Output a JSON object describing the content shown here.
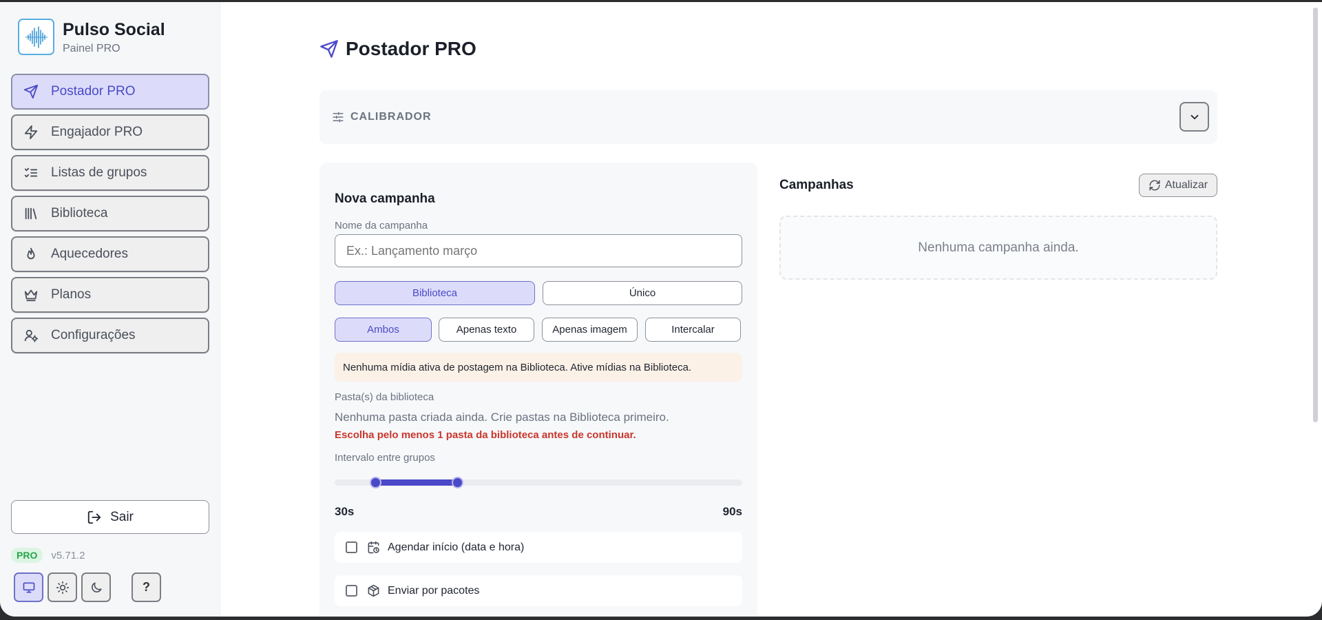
{
  "brand": {
    "title": "Pulso Social",
    "subtitle": "Painel PRO"
  },
  "nav": {
    "items": [
      {
        "label": "Postador PRO",
        "icon": "send-icon",
        "active": true
      },
      {
        "label": "Engajador PRO",
        "icon": "zap-icon"
      },
      {
        "label": "Listas de grupos",
        "icon": "list-checks-icon"
      },
      {
        "label": "Biblioteca",
        "icon": "library-icon"
      },
      {
        "label": "Aquecedores",
        "icon": "flame-icon"
      },
      {
        "label": "Planos",
        "icon": "crown-icon"
      },
      {
        "label": "Configurações",
        "icon": "user-cog-icon"
      }
    ]
  },
  "footer": {
    "logout_label": "Sair",
    "badge": "PRO",
    "version": "v5.71.2",
    "help_label": "?"
  },
  "page": {
    "title": "Postador PRO"
  },
  "calibrator": {
    "label": "CALIBRADOR"
  },
  "form": {
    "title": "Nova campanha",
    "name_label": "Nome da campanha",
    "name_placeholder": "Ex.: Lançamento março",
    "source_options": [
      "Biblioteca",
      "Único"
    ],
    "source_selected": "Biblioteca",
    "content_options": [
      "Ambos",
      "Apenas texto",
      "Apenas imagem",
      "Intercalar"
    ],
    "content_selected": "Ambos",
    "warning": "Nenhuma mídia ativa de postagem na Biblioteca. Ative mídias na Biblioteca.",
    "folders_label": "Pasta(s) da biblioteca",
    "folders_empty": "Nenhuma pasta criada ainda. Crie pastas na Biblioteca primeiro.",
    "folders_error": "Escolha pelo menos 1 pasta da biblioteca antes de continuar.",
    "interval_label": "Intervalo entre grupos",
    "interval_min_label": "30s",
    "interval_max_label": "90s",
    "interval_selection_fraction": [
      0.1,
      0.3
    ],
    "schedule_label": "Agendar início (data e hora)",
    "batches_label": "Enviar por pacotes"
  },
  "campaigns": {
    "title": "Campanhas",
    "refresh_label": "Atualizar",
    "empty": "Nenhuma campanha ainda."
  },
  "colors": {
    "accent": "#4a49c8",
    "accent_bg": "#dcdcfa",
    "error": "#c9362c",
    "warning_bg": "#fbf1e6",
    "pro_green": "#27a34a"
  }
}
